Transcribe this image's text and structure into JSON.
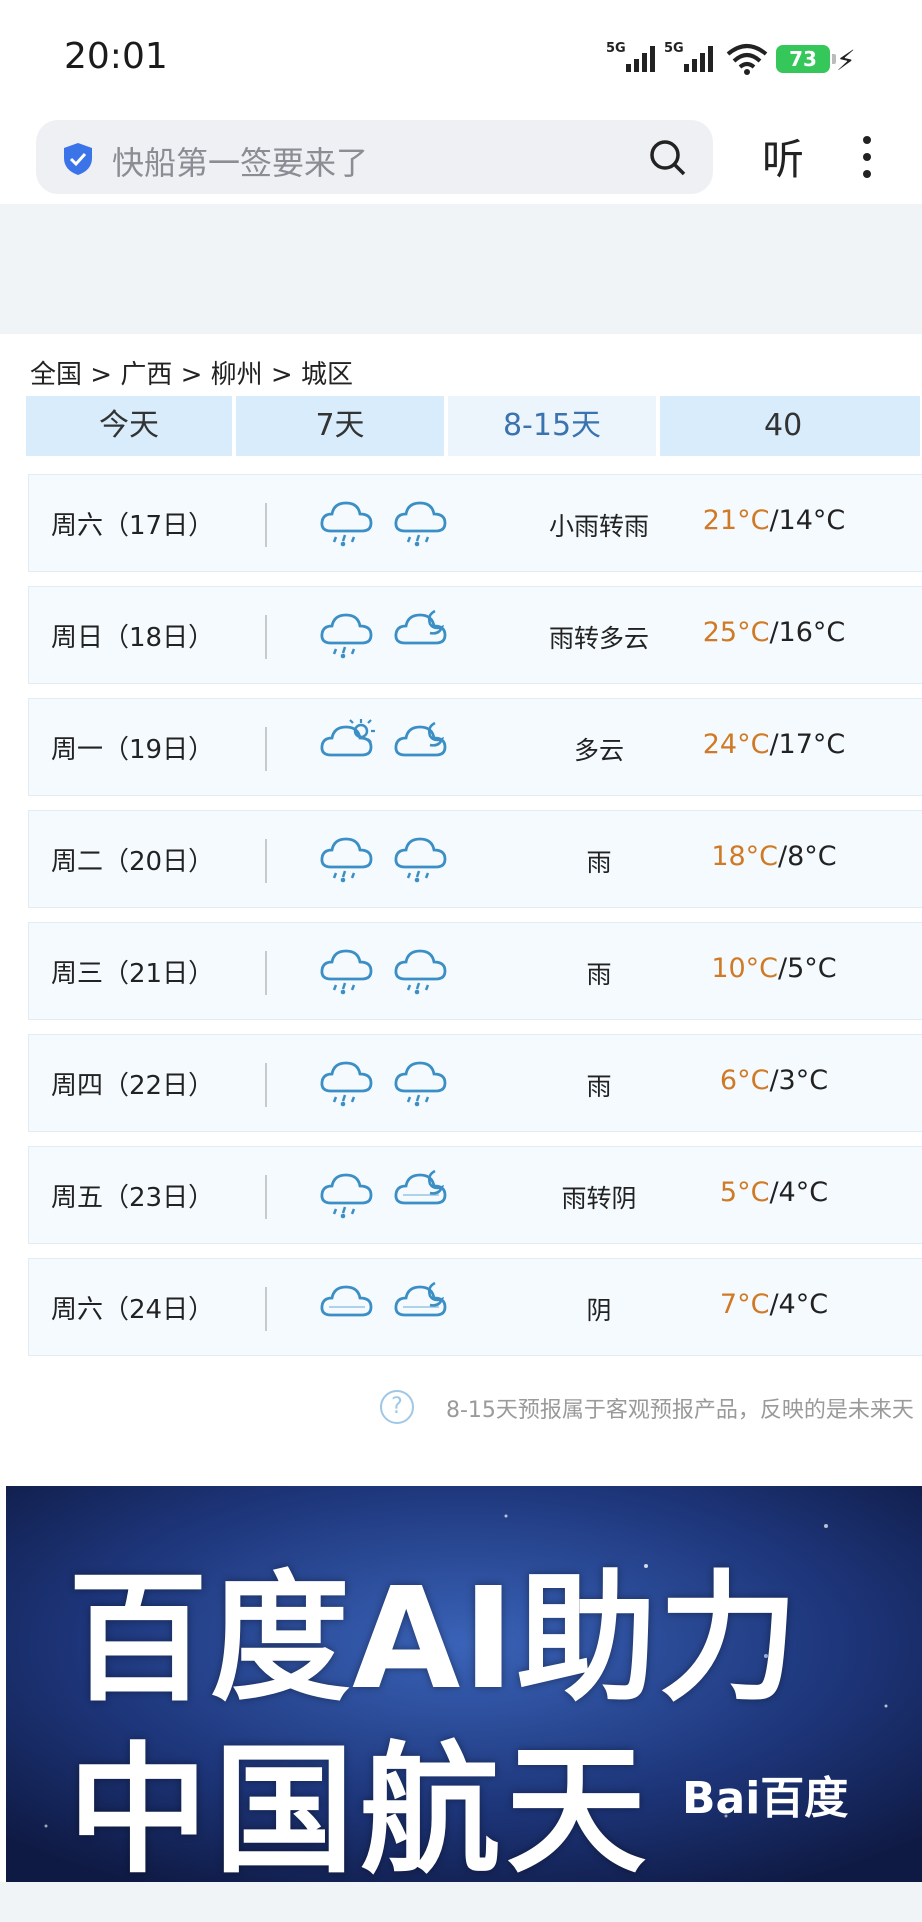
{
  "status": {
    "time": "20:01",
    "battery": "73",
    "net1": "5G",
    "net2": "5G"
  },
  "search": {
    "placeholder": "快船第一签要来了",
    "listen_label": "听"
  },
  "breadcrumb": "全国 > 广西 > 柳州 > 城区",
  "tabs": [
    "今天",
    "7天",
    "8-15天",
    "40"
  ],
  "forecast": [
    {
      "day": "周六（17日）",
      "icon1": "light-rain-icon",
      "icon2": "rain-icon",
      "desc": "小雨转雨",
      "high": "21°C",
      "low": "/14°C"
    },
    {
      "day": "周日（18日）",
      "icon1": "rain-icon",
      "icon2": "cloudy-night-icon",
      "desc": "雨转多云",
      "high": "25°C",
      "low": "/16°C"
    },
    {
      "day": "周一（19日）",
      "icon1": "partly-cloudy-icon",
      "icon2": "cloudy-night-icon",
      "desc": "多云",
      "high": "24°C",
      "low": "/17°C"
    },
    {
      "day": "周二（20日）",
      "icon1": "rain-icon",
      "icon2": "rain-icon",
      "desc": "雨",
      "high": "18°C",
      "low": "/8°C"
    },
    {
      "day": "周三（21日）",
      "icon1": "rain-icon",
      "icon2": "rain-icon",
      "desc": "雨",
      "high": "10°C",
      "low": "/5°C"
    },
    {
      "day": "周四（22日）",
      "icon1": "rain-icon",
      "icon2": "rain-icon",
      "desc": "雨",
      "high": "6°C",
      "low": "/3°C"
    },
    {
      "day": "周五（23日）",
      "icon1": "rain-icon",
      "icon2": "overcast-night-icon",
      "desc": "雨转阴",
      "high": "5°C",
      "low": "/4°C"
    },
    {
      "day": "周六（24日）",
      "icon1": "overcast-icon",
      "icon2": "overcast-night-icon",
      "desc": "阴",
      "high": "7°C",
      "low": "/4°C"
    }
  ],
  "note": "8-15天预报属于客观预报产品，反映的是未来天",
  "banner": {
    "line1": "百度AI助力",
    "line2": "中国航天",
    "logo": "Bai百度"
  },
  "colors": {
    "high_temp": "#d07a25",
    "tab_bg": "#d9ecfb",
    "tab_active_text": "#3a73b0",
    "icon_blue": "#3b8fc4"
  }
}
